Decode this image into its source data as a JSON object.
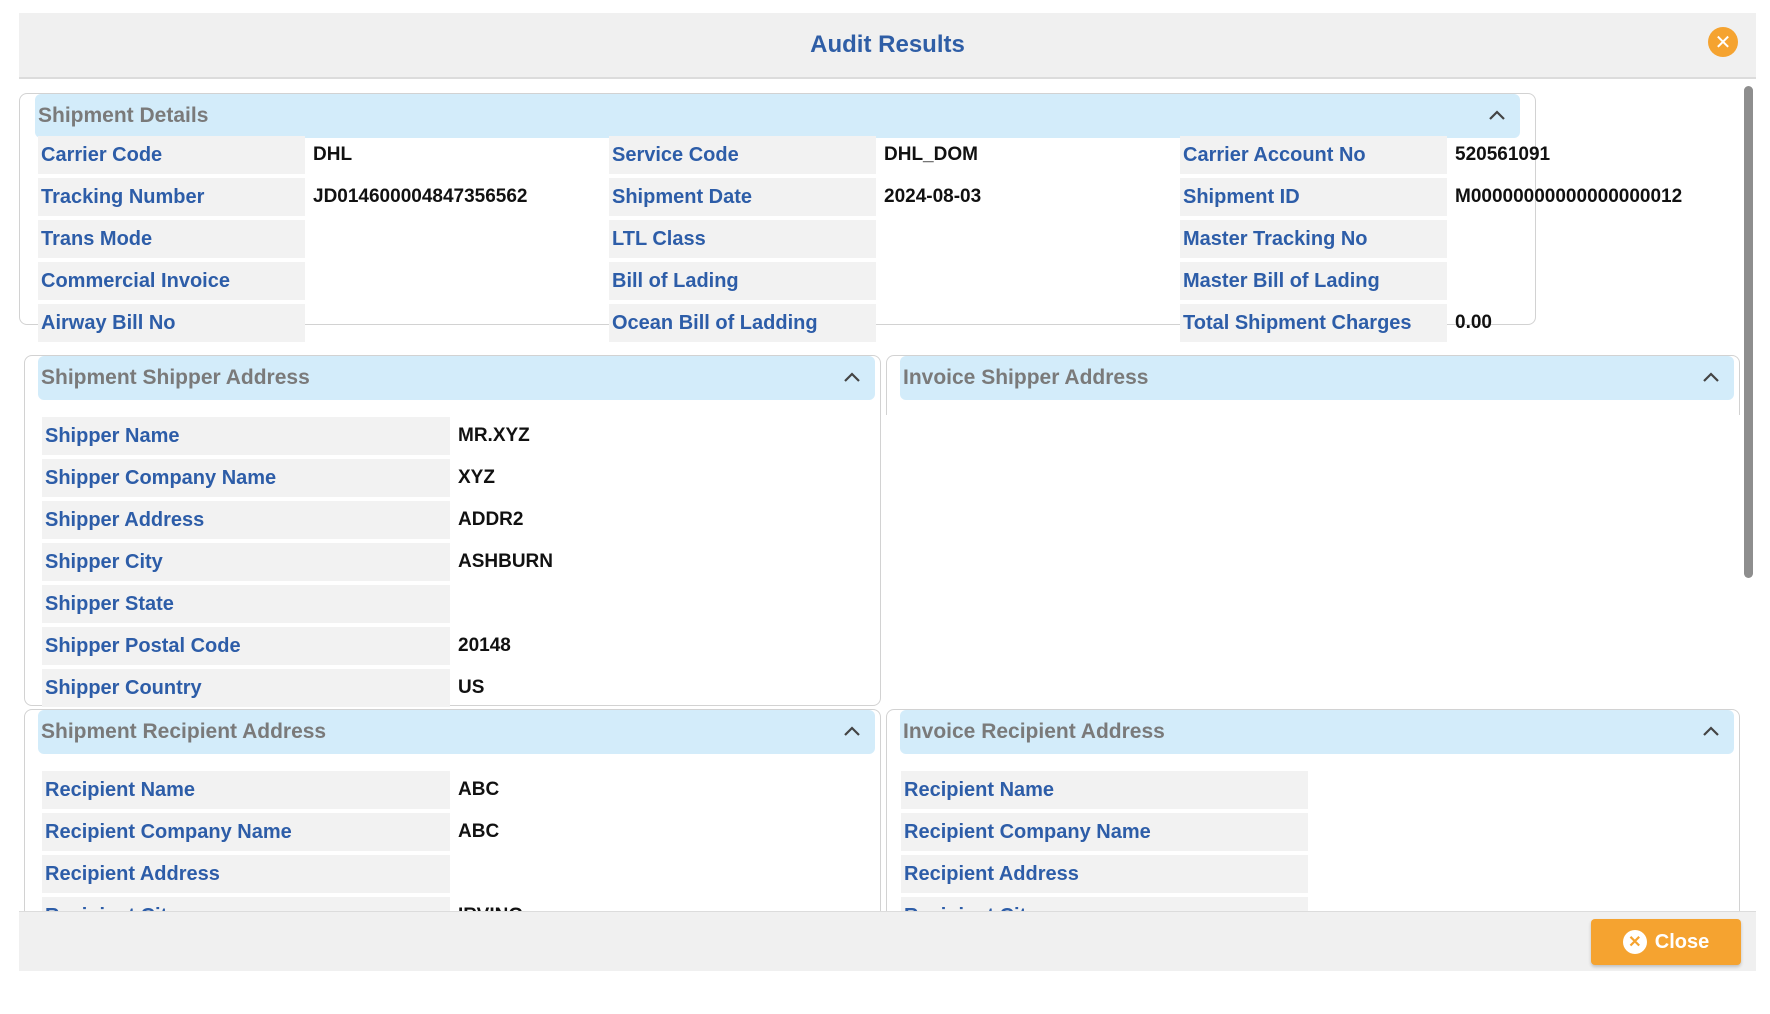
{
  "modal": {
    "title": "Audit Results",
    "close_button_label": "Close",
    "close_icon": "close-icon",
    "accent_color": "#f5a330",
    "label_color": "#2d5da8",
    "section_header_color": "#d3ecfa"
  },
  "shipment_details": {
    "title": "Shipment Details",
    "columns": [
      [
        {
          "label": "Carrier Code",
          "value": "DHL"
        },
        {
          "label": "Tracking Number",
          "value": "JD014600004847356562"
        },
        {
          "label": "Trans Mode",
          "value": ""
        },
        {
          "label": "Commercial Invoice",
          "value": ""
        },
        {
          "label": "Airway Bill No",
          "value": ""
        }
      ],
      [
        {
          "label": "Service Code",
          "value": "DHL_DOM"
        },
        {
          "label": "Shipment Date",
          "value": "2024-08-03"
        },
        {
          "label": "LTL Class",
          "value": ""
        },
        {
          "label": "Bill of Lading",
          "value": ""
        },
        {
          "label": "Ocean Bill of Ladding",
          "value": ""
        }
      ],
      [
        {
          "label": "Carrier Account No",
          "value": "520561091"
        },
        {
          "label": "Shipment ID",
          "value": "M00000000000000000012"
        },
        {
          "label": "Master Tracking No",
          "value": ""
        },
        {
          "label": "Master Bill of Lading",
          "value": ""
        },
        {
          "label": "Total Shipment Charges",
          "value": "0.00"
        }
      ]
    ]
  },
  "shipment_shipper": {
    "title": "Shipment Shipper Address",
    "rows": [
      {
        "label": "Shipper Name",
        "value": "MR.XYZ"
      },
      {
        "label": "Shipper Company Name",
        "value": "XYZ"
      },
      {
        "label": "Shipper Address",
        "value": "ADDR2"
      },
      {
        "label": "Shipper City",
        "value": "ASHBURN"
      },
      {
        "label": "Shipper State",
        "value": ""
      },
      {
        "label": "Shipper Postal Code",
        "value": "20148"
      },
      {
        "label": "Shipper Country",
        "value": "US"
      }
    ]
  },
  "invoice_shipper": {
    "title": "Invoice Shipper Address"
  },
  "shipment_recipient": {
    "title": "Shipment Recipient Address",
    "rows": [
      {
        "label": "Recipient Name",
        "value": "ABC"
      },
      {
        "label": "Recipient Company Name",
        "value": "ABC"
      },
      {
        "label": "Recipient Address",
        "value": ""
      },
      {
        "label": "Recipient City",
        "value": "IRVING"
      }
    ]
  },
  "invoice_recipient": {
    "title": "Invoice Recipient Address",
    "rows": [
      {
        "label": "Recipient Name",
        "value": ""
      },
      {
        "label": "Recipient Company Name",
        "value": ""
      },
      {
        "label": "Recipient Address",
        "value": ""
      },
      {
        "label": "Recipient City",
        "value": ""
      }
    ]
  }
}
